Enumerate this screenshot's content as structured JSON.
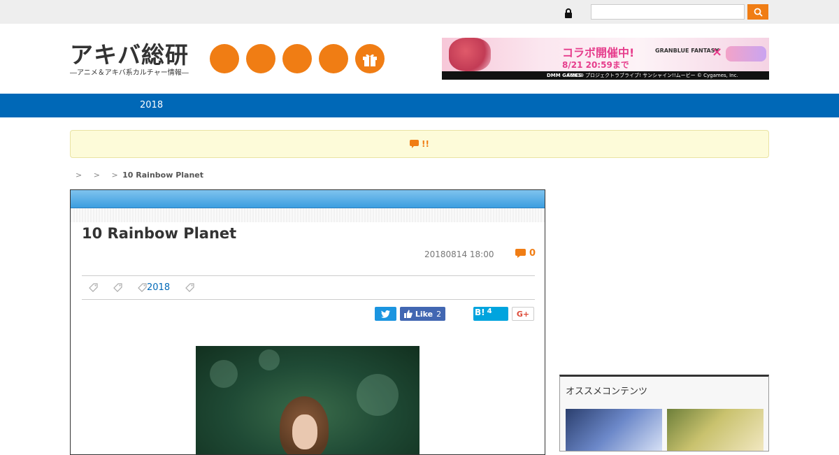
{
  "topbar": {
    "search_placeholder": "",
    "search_icon": "search-icon",
    "lock_icon": "lock-icon"
  },
  "header": {
    "logo_main": "アキバ総研",
    "logo_sub": "―アニメ＆アキバ系カルチャー情報―",
    "social_icons": [
      "circle-icon",
      "circle-icon",
      "circle-icon",
      "circle-icon",
      "gift-icon"
    ],
    "banner": {
      "collab": "コラボ開催中!",
      "date": "8/21 20:59まで",
      "game": "GRANBLUE FANTASY",
      "cross": "×",
      "footer_brand": "DMM GAMES",
      "footer_text": "©2019 プロジェクトラブライブ! サンシャイン!!ムービー © Cygames, Inc."
    }
  },
  "nav": {
    "items": [
      "2018"
    ]
  },
  "notice": {
    "text": "!!"
  },
  "breadcrumb": {
    "seps": [
      ">",
      ">",
      ">"
    ],
    "current": "10 Rainbow Planet"
  },
  "article": {
    "title": "10 Rainbow Planet",
    "date": "20180814 18:00",
    "comments": "0",
    "tags": [
      "",
      "",
      "2018",
      ""
    ],
    "share": {
      "like_label": "Like",
      "like_count": "2",
      "hatena_label": "B!",
      "hatena_count": "4",
      "gplus_label": "G+"
    }
  },
  "sidebar": {
    "widget_title": "オススメコンテンツ"
  },
  "colors": {
    "accent": "#f07d14",
    "nav_blue": "#0068b7",
    "notice_bg": "#fdfbd9"
  }
}
